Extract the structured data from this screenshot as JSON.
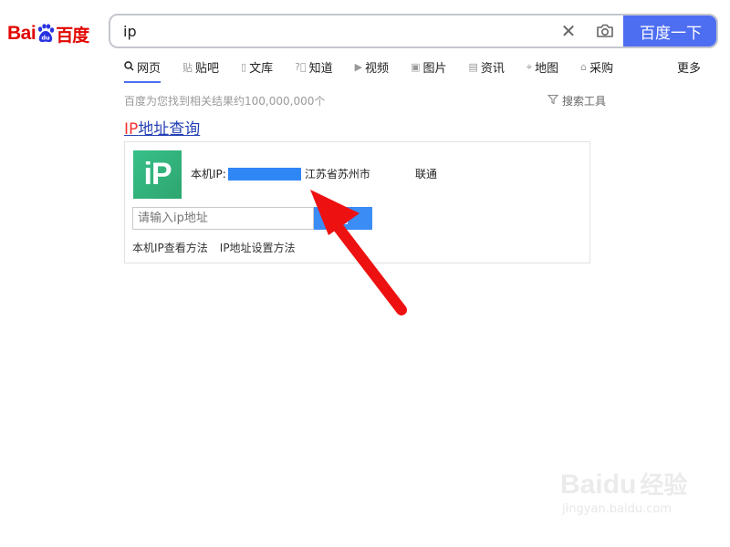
{
  "logo": {
    "latin": "Bai",
    "paw_text": "du",
    "chinese": "百度"
  },
  "search": {
    "query": "ip",
    "clear_icon": "✕",
    "camera_icon": "camera-icon",
    "button_label": "百度一下"
  },
  "tabs": [
    {
      "icon": "search-icon",
      "label": "网页"
    },
    {
      "icon": "tieba-icon",
      "label": "贴吧"
    },
    {
      "icon": "doc-icon",
      "label": "文库"
    },
    {
      "icon": "question-icon",
      "label": "知道"
    },
    {
      "icon": "video-icon",
      "label": "视频"
    },
    {
      "icon": "image-icon",
      "label": "图片"
    },
    {
      "icon": "news-icon",
      "label": "资讯"
    },
    {
      "icon": "map-icon",
      "label": "地图"
    },
    {
      "icon": "shopping-icon",
      "label": "采购"
    }
  ],
  "more_label": "更多",
  "result_count": "百度为您找到相关结果约100,000,000个",
  "search_tools": "搜索工具",
  "result": {
    "title_highlight": "IP",
    "title_rest": "地址查询",
    "logo_text": "iP",
    "ip_label": "本机IP: ",
    "location": "江苏省苏州市",
    "isp": "联通",
    "input_placeholder": "请输入ip地址",
    "query_button": "询",
    "links": [
      "本机IP查看方法",
      "IP地址设置方法"
    ]
  },
  "watermark": {
    "logo_latin": "Bai",
    "logo_paw": "du",
    "logo_cn": "经验",
    "url": "jingyan.baidu.com"
  },
  "colors": {
    "brand_red": "#e10601",
    "brand_blue": "#4e6ef2",
    "link_blue": "#2440b3",
    "highlight_red": "#f73131",
    "ip_green": "#38c08a",
    "arrow_red": "#ee1111"
  }
}
